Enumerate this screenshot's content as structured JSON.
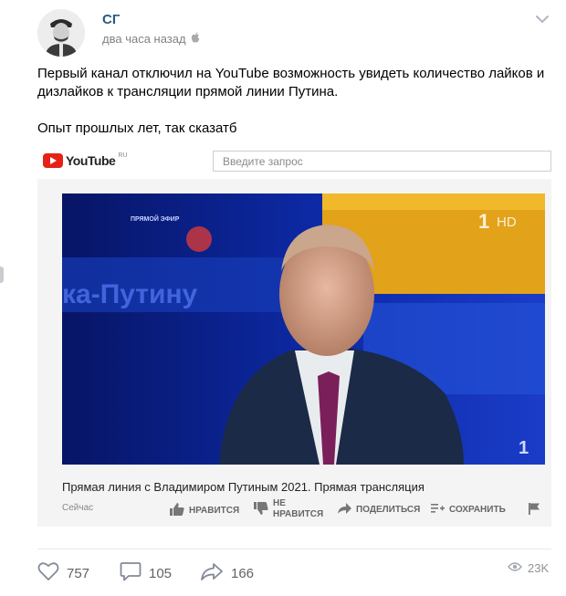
{
  "post": {
    "author": "СГ",
    "time": "два часа назад",
    "text_paragraph_1": "Первый канал отключил на YouTube возможность увидеть количество лайков и дизлайков к трансляции прямой линии Путина.",
    "text_paragraph_2": "Опыт прошлых лет, так сказатб"
  },
  "embed": {
    "logo_text": "YouTube",
    "logo_region": "RU",
    "search_placeholder": "Введите запрос",
    "video_overlay_caption": "ПРЯМОЙ ЭФИР",
    "video_overlay_text": "ка-Путину",
    "channel_badge": "1",
    "channel_hd": "HD",
    "video_title": "Прямая линия с Владимиром Путиным 2021. Прямая трансляция",
    "video_time": "Сейчас",
    "actions": {
      "like": "НРАВИТСЯ",
      "dislike_line1": "НЕ",
      "dislike_line2": "НРАВИТСЯ",
      "share": "ПОДЕЛИТЬСЯ",
      "save": "СОХРАНИТЬ"
    }
  },
  "footer": {
    "likes": "757",
    "comments": "105",
    "reposts": "166",
    "views": "23K"
  },
  "colors": {
    "author_link": "#2a5885",
    "youtube_red": "#e62117",
    "muted": "#828282"
  }
}
